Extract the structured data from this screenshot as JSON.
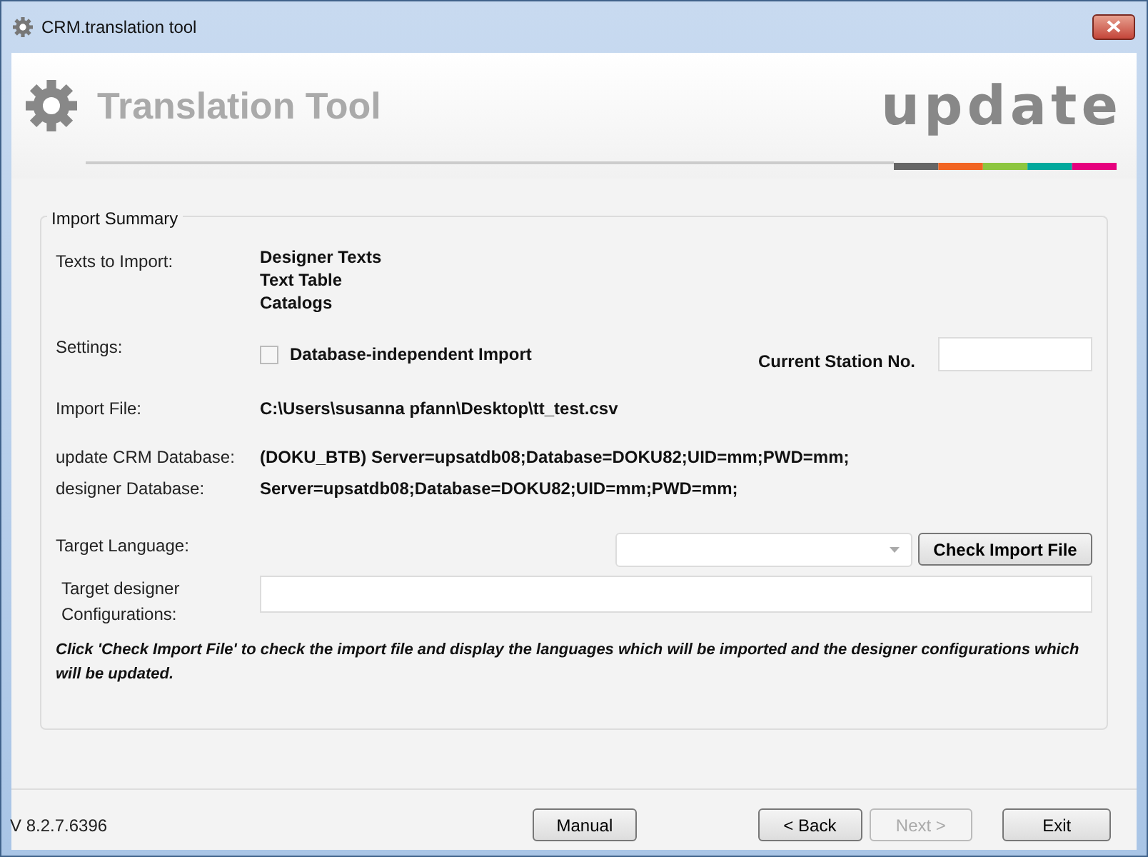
{
  "window": {
    "title": "CRM.translation tool"
  },
  "header": {
    "title": "Translation Tool",
    "logo": "update"
  },
  "import_summary": {
    "legend": "Import Summary",
    "texts_to_import": {
      "label": "Texts to Import:",
      "items": [
        "Designer Texts",
        "Text Table",
        "Catalogs"
      ]
    },
    "settings": {
      "label": "Settings:",
      "checkbox": {
        "label": "Database-independent Import",
        "checked": false
      },
      "station_label": "Current Station No."
    },
    "import_file": {
      "label": "Import File:",
      "value": "C:\\Users\\susanna pfann\\Desktop\\tt_test.csv"
    },
    "crm_database": {
      "label": "update CRM Database:",
      "value": "(DOKU_BTB) Server=upsatdb08;Database=DOKU82;UID=mm;PWD=mm;"
    },
    "designer_database": {
      "label": "designer Database:",
      "value": "Server=upsatdb08;Database=DOKU82;UID=mm;PWD=mm;"
    },
    "target_language": {
      "label": "Target Language:",
      "button": "Check Import File"
    },
    "target_configurations": {
      "label": "Target designer Configurations:"
    },
    "hint": "Click 'Check Import File' to check the import file and display the languages which will be imported and the designer configurations which will be updated."
  },
  "footer": {
    "version": "V 8.2.7.6396",
    "buttons": [
      {
        "label": "Manual",
        "disabled": false
      },
      {
        "label": "< Back",
        "disabled": false
      },
      {
        "label": "Next >",
        "disabled": true
      },
      {
        "label": "Exit",
        "disabled": false
      }
    ]
  }
}
